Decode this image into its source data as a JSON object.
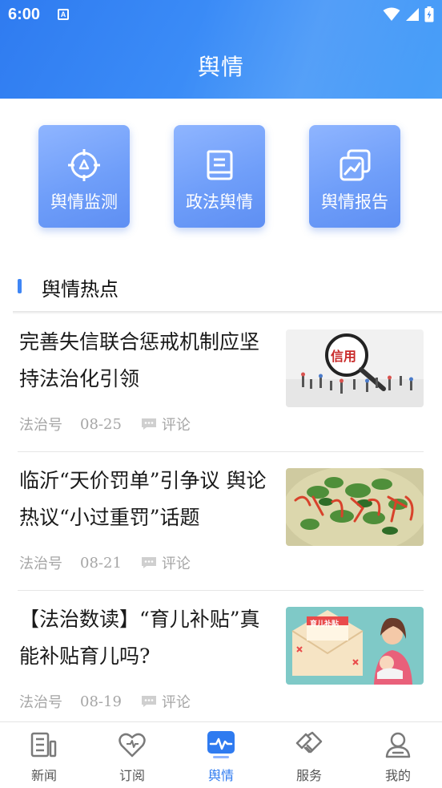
{
  "status_bar": {
    "time": "6:00",
    "notif_letter": "A"
  },
  "header": {
    "title": "舆情"
  },
  "tiles": [
    {
      "label": "舆情监测",
      "icon": "target-icon"
    },
    {
      "label": "政法舆情",
      "icon": "document-icon"
    },
    {
      "label": "舆情报告",
      "icon": "report-chart-icon"
    }
  ],
  "section": {
    "title": "舆情热点"
  },
  "news": [
    {
      "title": "完善失信联合惩戒机制应坚持法治化引领",
      "source": "法治号",
      "date": "08-25",
      "comment_label": "评论",
      "thumb_text": "信用"
    },
    {
      "title": "临沂“天价罚单”引争议 舆论热议“小过重罚”话题",
      "source": "法治号",
      "date": "08-21",
      "comment_label": "评论"
    },
    {
      "title": "【法治数读】“育儿补贴”真能补贴育儿吗?",
      "source": "法治号",
      "date": "08-19",
      "comment_label": "评论",
      "thumb_text": "育儿补贴"
    }
  ],
  "bottom_nav": [
    {
      "label": "新闻",
      "icon": "news-icon",
      "active": false
    },
    {
      "label": "订阅",
      "icon": "heart-icon",
      "active": false
    },
    {
      "label": "舆情",
      "icon": "pulse-icon",
      "active": true
    },
    {
      "label": "服务",
      "icon": "handshake-icon",
      "active": false
    },
    {
      "label": "我的",
      "icon": "user-icon",
      "active": false
    }
  ],
  "colors": {
    "accent": "#2f7bf0",
    "tile": "#6f9ef9",
    "meta": "#a6a6a6"
  }
}
